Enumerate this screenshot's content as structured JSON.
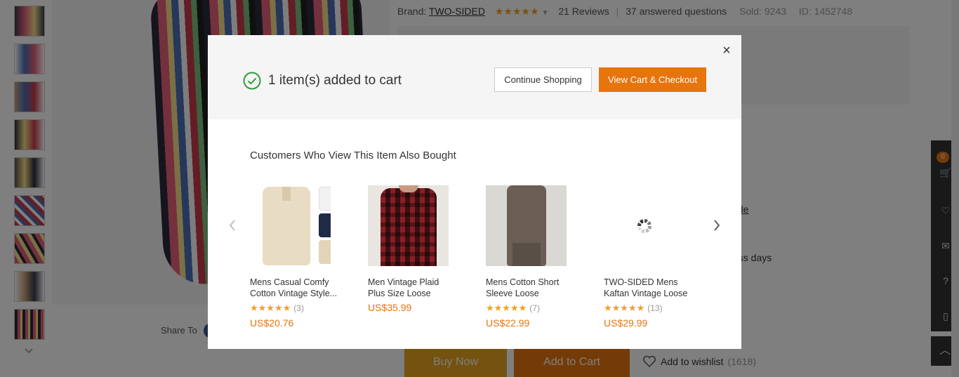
{
  "background": {
    "brand_label": "Brand:",
    "brand_name": "TWO-SIDED",
    "rating_stars": "★★★★★",
    "reviews": "21 Reviews",
    "questions": "37 answered questions",
    "sold": "Sold: 9243",
    "product_id": "ID: 1452748",
    "size_guide": "uide",
    "delivery_days": "ess days",
    "share_label": "Share To",
    "buy_now": "Buy Now",
    "add_to_cart": "Add to Cart",
    "wishlist_label": "Add to wishlist",
    "wishlist_count": "(1618)",
    "cart_badge": "0"
  },
  "modal": {
    "close_glyph": "×",
    "added_text": "1 item(s) added to cart",
    "continue_label": "Continue Shopping",
    "checkout_label": "View Cart & Checkout",
    "recommend_title": "Customers Who View This Item Also Bought",
    "products": [
      {
        "name": "Mens Casual Comfy Cotton Vintage Style...",
        "stars": "★★★★★",
        "reviews": "(3)",
        "price": "US$20.76"
      },
      {
        "name": "Men Vintage Plaid Plus Size Loose Checkered...",
        "price": "US$35.99"
      },
      {
        "name": "Mens Cotton Short Sleeve Loose Romper...",
        "stars": "★★★★★",
        "reviews": "(7)",
        "price": "US$22.99"
      },
      {
        "name": "TWO-SIDED Mens Kaftan Vintage Loose ...",
        "stars": "★★★★★",
        "reviews": "(13)",
        "price": "US$29.99"
      }
    ]
  },
  "colors": {
    "accent_orange": "#e8740e",
    "buy_now_yellow": "#e8a41e",
    "star_color": "#f0a21a",
    "check_green": "#2e9e3a"
  }
}
